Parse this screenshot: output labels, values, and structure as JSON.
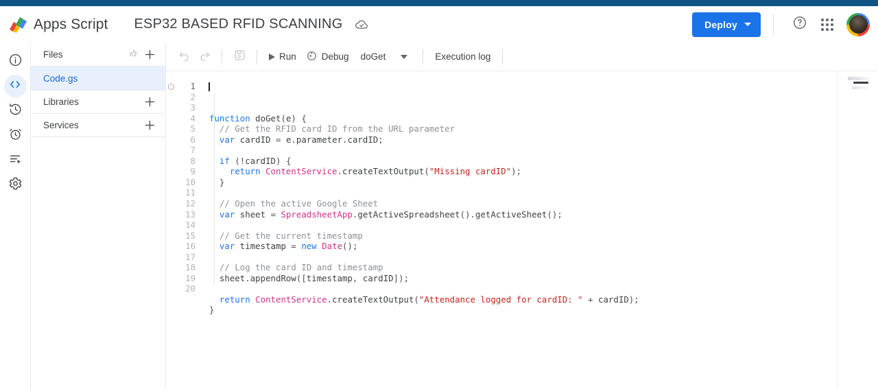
{
  "theme": {
    "accent_bar": "#0f5484",
    "primary_button": "#1a73e8",
    "selected_file_bg": "#e8f0fe",
    "selected_file_text": "#1967d2",
    "keyword": "#1a73e8",
    "class_name": "#d0318a",
    "string": "#c5221f",
    "comment": "#8c9196"
  },
  "header": {
    "brand": "Apps Script",
    "project_title": "ESP32 BASED RFID SCANNING",
    "cloud_status_icon": "cloud-done-icon",
    "deploy_label": "Deploy",
    "help_icon": "help-circle-icon",
    "apps_icon": "apps-grid-icon",
    "avatar_icon": "account-avatar"
  },
  "rail": {
    "items": [
      {
        "name": "overview",
        "icon": "info-circle-icon",
        "active": false
      },
      {
        "name": "editor",
        "icon": "code-brackets-icon",
        "active": true
      },
      {
        "name": "project-history",
        "icon": "history-clock-icon",
        "active": false
      },
      {
        "name": "triggers",
        "icon": "alarm-clock-icon",
        "active": false
      },
      {
        "name": "executions",
        "icon": "executions-list-icon",
        "active": false
      },
      {
        "name": "project-settings",
        "icon": "gear-icon",
        "active": false
      }
    ]
  },
  "files_panel": {
    "sections": [
      {
        "title": "Files",
        "sort_icon": "sort-az-icon",
        "add_icon": "plus-icon"
      },
      {
        "title": "Libraries",
        "add_icon": "plus-icon"
      },
      {
        "title": "Services",
        "add_icon": "plus-icon"
      }
    ],
    "files": [
      {
        "name": "Code.gs",
        "selected": true
      }
    ]
  },
  "editor_toolbar": {
    "undo_icon": "undo-arrow-icon",
    "redo_icon": "redo-arrow-icon",
    "save_icon": "save-project-icon",
    "run_label": "Run",
    "run_icon": "play-triangle-icon",
    "debug_label": "Debug",
    "debug_icon": "debug-icon",
    "function_selected": "doGet",
    "function_caret_icon": "chevron-down-icon",
    "execution_log_label": "Execution log"
  },
  "editor": {
    "file": "Code.gs",
    "active_line": 1,
    "total_lines": 20,
    "line_numbers": [
      "1",
      "2",
      "3",
      "4",
      "5",
      "6",
      "7",
      "8",
      "9",
      "10",
      "11",
      "12",
      "13",
      "14",
      "15",
      "16",
      "17",
      "18",
      "19",
      "20"
    ],
    "code_lines": [
      "function doGet(e) {",
      "  // Get the RFID card ID from the URL parameter",
      "  var cardID = e.parameter.cardID;",
      "",
      "  if (!cardID) {",
      "    return ContentService.createTextOutput(\"Missing cardID\");",
      "  }",
      "",
      "  // Open the active Google Sheet",
      "  var sheet = SpreadsheetApp.getActiveSpreadsheet().getActiveSheet();",
      "",
      "  // Get the current timestamp",
      "  var timestamp = new Date();",
      "",
      "  // Log the card ID and timestamp",
      "  sheet.appendRow([timestamp, cardID]);",
      "",
      "  return ContentService.createTextOutput(\"Attendance logged for cardID: \" + cardID);",
      "}",
      ""
    ]
  }
}
